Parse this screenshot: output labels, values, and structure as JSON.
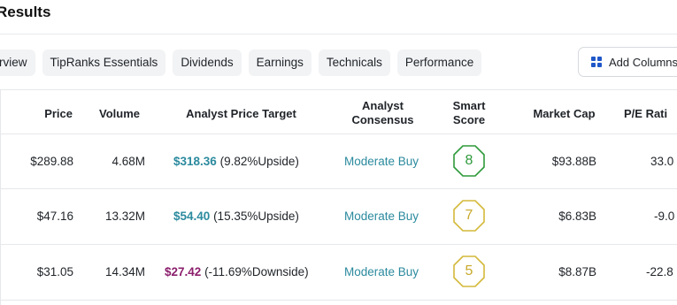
{
  "page_title": "Results",
  "tabs": [
    "rview",
    "TipRanks Essentials",
    "Dividends",
    "Earnings",
    "Technicals",
    "Performance"
  ],
  "add_columns_label": "Add Columns",
  "columns": {
    "price": "Price",
    "volume": "Volume",
    "target": "Analyst Price Target",
    "consensus_l1": "Analyst",
    "consensus_l2": "Consensus",
    "score_l1": "Smart",
    "score_l2": "Score",
    "market_cap": "Market Cap",
    "pe": "P/E Rati"
  },
  "rows": [
    {
      "price": "$289.88",
      "volume": "4.68M",
      "target_value": "$318.36",
      "target_note": "(9.82%Upside)",
      "consensus": "Moderate Buy",
      "score": "8",
      "market_cap": "$93.88B",
      "pe": "33.0"
    },
    {
      "price": "$47.16",
      "volume": "13.32M",
      "target_value": "$54.40",
      "target_note": "(15.35%Upside)",
      "consensus": "Moderate Buy",
      "score": "7",
      "market_cap": "$6.83B",
      "pe": "-9.0"
    },
    {
      "price": "$31.05",
      "volume": "14.34M",
      "target_value": "$27.42",
      "target_note": "(-11.69%Downside)",
      "consensus": "Moderate Buy",
      "score": "5",
      "market_cap": "$8.87B",
      "pe": "-22.8"
    }
  ],
  "colors": {
    "upside": "#2b8a9e",
    "downside": "#8b1f6c",
    "score_high": "#2e9a3a",
    "score_mid": "#d4b93a"
  },
  "icons": {
    "add_columns": "columns-grid-icon"
  }
}
